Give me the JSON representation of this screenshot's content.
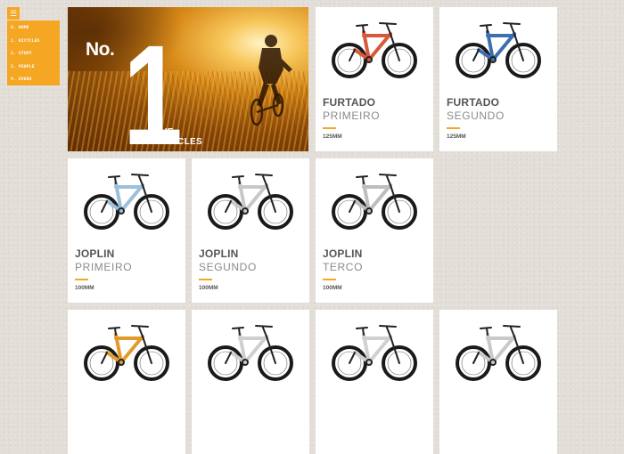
{
  "menu": {
    "toggle_icon": "hamburger-icon",
    "items": [
      {
        "label": "0. HOME"
      },
      {
        "label": "1. BICYCLES"
      },
      {
        "label": "2. STUFF"
      },
      {
        "label": "3. PEOPLE"
      },
      {
        "label": "4. EVENS"
      }
    ]
  },
  "hero": {
    "prefix": "No.",
    "number": "1",
    "line1": "THE",
    "line2": "BICYCLES"
  },
  "colors": {
    "accent": "#f5a623",
    "background": "#e2ddd7"
  },
  "bikes": [
    {
      "model": "FURTADO",
      "variant": "PRIMEIRO",
      "travel": "125MM",
      "frame_color": "#d9583a"
    },
    {
      "model": "FURTADO",
      "variant": "SEGUNDO",
      "travel": "125MM",
      "frame_color": "#3d6fb0"
    },
    {
      "model": "JOPLIN",
      "variant": "PRIMEIRO",
      "travel": "100MM",
      "frame_color": "#9cc0da"
    },
    {
      "model": "JOPLIN",
      "variant": "SEGUNDO",
      "travel": "100MM",
      "frame_color": "#c8c8c8"
    },
    {
      "model": "JOPLIN",
      "variant": "TERCO",
      "travel": "100MM",
      "frame_color": "#bdbdbd"
    },
    {
      "model": "",
      "variant": "",
      "travel": "",
      "frame_color": "#e39a2c"
    },
    {
      "model": "",
      "variant": "",
      "travel": "",
      "frame_color": "#cfcfcf"
    },
    {
      "model": "",
      "variant": "",
      "travel": "",
      "frame_color": "#d0d0d0"
    },
    {
      "model": "",
      "variant": "",
      "travel": "",
      "frame_color": "#c9c9c9"
    }
  ]
}
